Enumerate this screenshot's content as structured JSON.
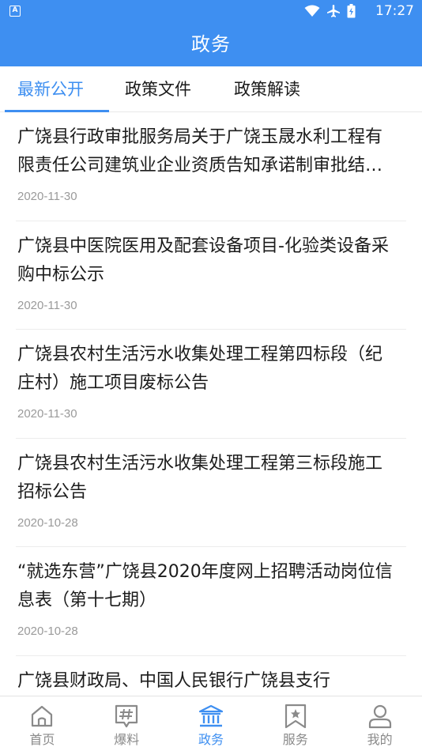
{
  "status_bar": {
    "time": "17:27",
    "icons": [
      "notification-a-icon",
      "wifi-icon",
      "airplane-icon",
      "battery-icon"
    ],
    "badge_letter": "A"
  },
  "header": {
    "title": "政务"
  },
  "tabs": [
    {
      "label": "最新公开",
      "active": true
    },
    {
      "label": "政策文件",
      "active": false
    },
    {
      "label": "政策解读",
      "active": false
    }
  ],
  "news": [
    {
      "title": "广饶县行政审批服务局关于广饶玉晟水利工程有限责任公司建筑业企业资质告知承诺制审批结果的公示",
      "date": "2020-11-30"
    },
    {
      "title": "广饶县中医院医用及配套设备项目-化验类设备采购中标公示",
      "date": "2020-11-30"
    },
    {
      "title": "广饶县农村生活污水收集处理工程第四标段（纪庄村）施工项目废标公告",
      "date": "2020-11-30"
    },
    {
      "title": "广饶县农村生活污水收集处理工程第三标段施工招标公告",
      "date": "2020-10-28"
    },
    {
      "title": "“就选东营”广饶县2020年度网上招聘活动岗位信息表（第十七期）",
      "date": "2020-10-28"
    },
    {
      "title": "广饶县财政局、中国人民银行广饶县支行",
      "date": ""
    }
  ],
  "bottom_nav": [
    {
      "label": "首页",
      "icon": "home-icon",
      "active": false
    },
    {
      "label": "爆料",
      "icon": "hashtag-icon",
      "active": false
    },
    {
      "label": "政务",
      "icon": "government-icon",
      "active": true
    },
    {
      "label": "服务",
      "icon": "bookmark-star-icon",
      "active": false
    },
    {
      "label": "我的",
      "icon": "user-icon",
      "active": false
    }
  ],
  "colors": {
    "primary": "#3e8ff1",
    "text": "#1c1c1c",
    "muted": "#9a9a9a",
    "nav_inactive": "#8a8a8a"
  }
}
